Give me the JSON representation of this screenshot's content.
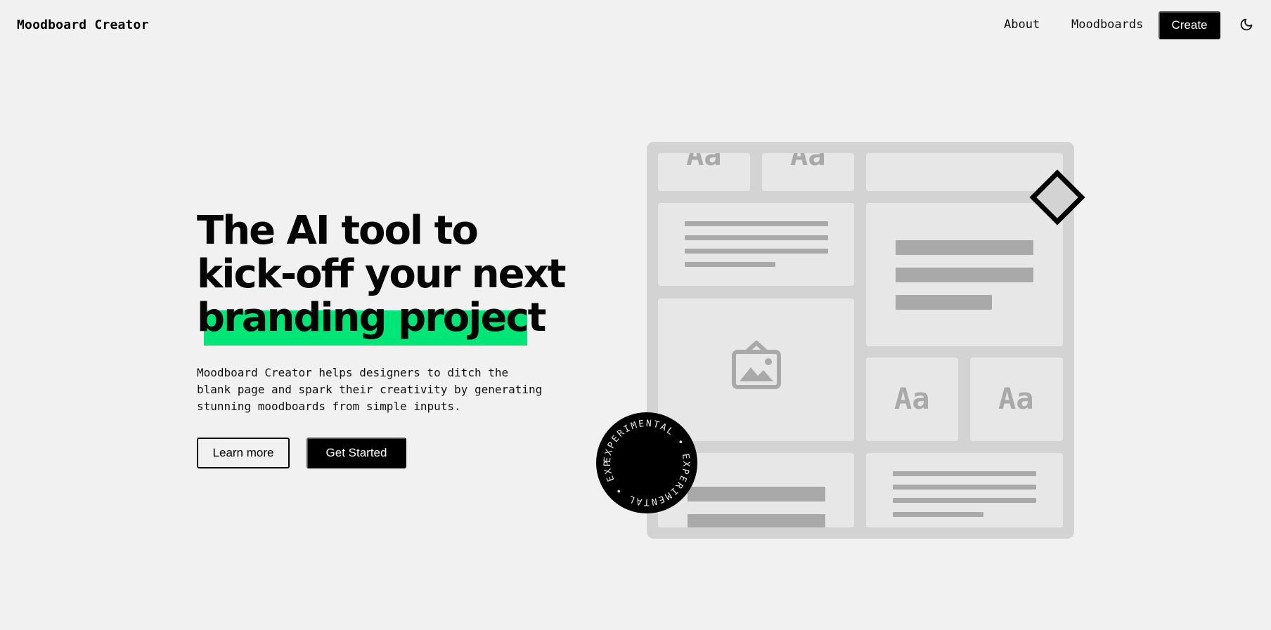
{
  "header": {
    "logo": "Moodboard Creator",
    "nav": {
      "about": "About",
      "moodboards": "Moodboards",
      "create": "Create"
    },
    "theme_icon": "moon-icon"
  },
  "hero": {
    "title_line1": "The AI tool to",
    "title_line2": "kick-off your next",
    "title_line3": "branding project",
    "description_line1": "Moodboard Creator helps designers to ditch the",
    "description_line2": "blank page and spark their creativity by generating",
    "description_line3": "stunning moodboards from simple inputs.",
    "learn_more": "Learn more",
    "get_started": "Get Started",
    "highlight_color": "#00e676"
  },
  "illustration": {
    "type_sample": "Aa",
    "badge_text": "EXPERIMENTAL • EXPERIMENTAL • EXPERIMENTAL •",
    "image_icon": "image-placeholder-icon",
    "shape_icon": "diamond-icon"
  }
}
